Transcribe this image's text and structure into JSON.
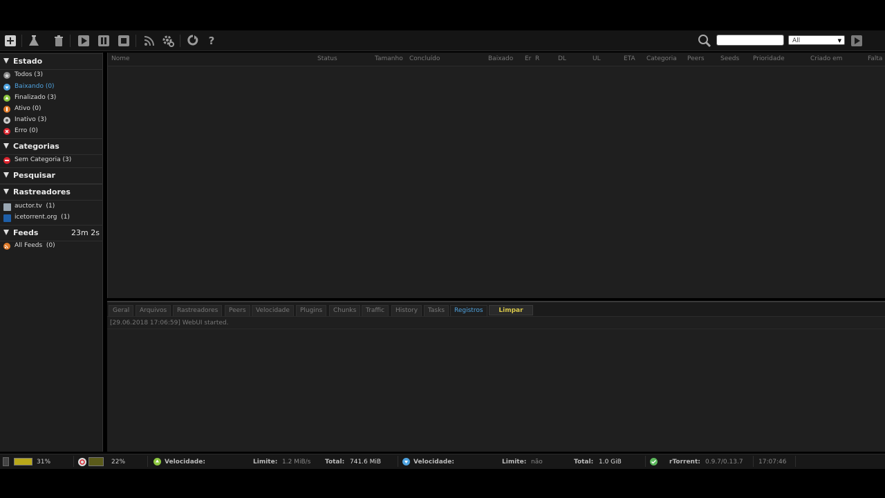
{
  "toolbar": {
    "icons": [
      "add-torrent-icon",
      "create-torrent-icon",
      "delete-icon",
      "start-icon",
      "pause-icon",
      "stop-icon",
      "rss-icon",
      "settings-icon",
      "plugins-icon",
      "help-icon"
    ],
    "help_glyph": "?",
    "search": {
      "placeholder": "",
      "filter_value": "All"
    }
  },
  "sidebar": {
    "estado": {
      "title": "Estado",
      "items": [
        {
          "label": "Todos (3)",
          "color": "#888888"
        },
        {
          "label": "Baixando (0)",
          "color": "#4fa3e0"
        },
        {
          "label": "Finalizado (3)",
          "color": "#8cc63f"
        },
        {
          "label": "Ativo (0)",
          "color": "#e07b2a"
        },
        {
          "label": "Inativo (3)",
          "color": "#cccccc"
        },
        {
          "label": "Erro (0)",
          "color": "#d9232d"
        }
      ]
    },
    "categorias": {
      "title": "Categorias",
      "items": [
        {
          "label": "Sem Categoria (3)",
          "color": "#d9232d"
        }
      ]
    },
    "pesquisar": {
      "title": "Pesquisar"
    },
    "rastreadores": {
      "title": "Rastreadores",
      "items": [
        {
          "label": "auctor.tv  (1)"
        },
        {
          "label": "icetorrent.org  (1)"
        }
      ]
    },
    "feeds": {
      "title": "Feeds",
      "timer": "23m 2s",
      "items": [
        {
          "label": "All Feeds  (0)",
          "color": "#e07b2a"
        }
      ]
    }
  },
  "columns": [
    "Nome",
    "Status",
    "Tamanho",
    "Concluído",
    "Baixado",
    "Er",
    "R",
    "DL",
    "UL",
    "ETA",
    "Categoria",
    "Peers",
    "Seeds",
    "Prioridade",
    "Criado em",
    "Falta"
  ],
  "tabs": [
    "Geral",
    "Arquivos",
    "Rastreadores",
    "Peers",
    "Velocidade",
    "Plugins",
    "Chunks",
    "Traffic",
    "History",
    "Tasks",
    "Registros"
  ],
  "active_tab": "Registros",
  "clear_label": "Limpar",
  "log": [
    "[29.06.2018 17:06:59] WebUI started."
  ],
  "statusbar": {
    "disk_percent": "31%",
    "cpu_percent": "22%",
    "down_label": "Velocidade:",
    "down_limit_label": "Limite:",
    "down_limit_value": "1.2 MiB/s",
    "down_total_label": "Total:",
    "down_total_value": "741.6 MiB",
    "up_label": "Velocidade:",
    "up_limit_label": "Limite:",
    "up_limit_value": "não",
    "up_total_label": "Total:",
    "up_total_value": "1.0 GiB",
    "client_label": "rTorrent:",
    "client_version": "0.9.7/0.13.7",
    "time": "17:07:46"
  }
}
